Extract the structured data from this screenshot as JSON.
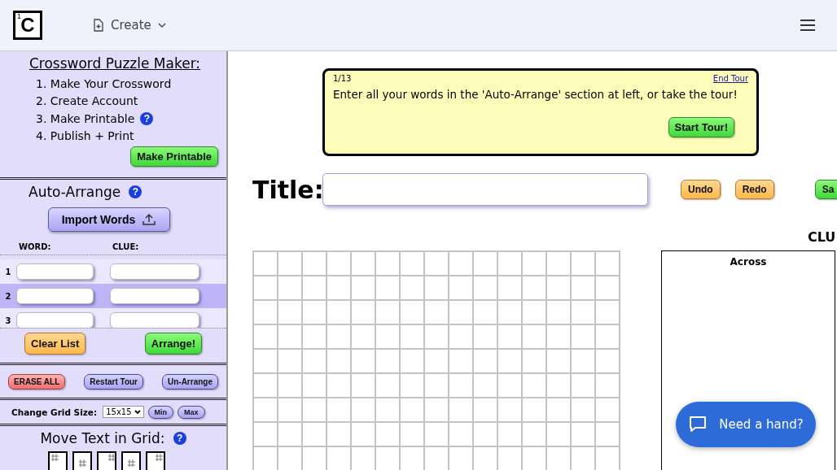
{
  "header": {
    "logo": {
      "number": "1",
      "letter": "C"
    },
    "create_menu": {
      "label": "Create"
    }
  },
  "sidebar": {
    "title": "Crossword Puzzle Maker:",
    "steps": [
      {
        "text": "1. Make Your Crossword"
      },
      {
        "text": "2. Create Account"
      },
      {
        "text": "3. Make Printable",
        "help": "?"
      },
      {
        "text": "4. Publish + Print"
      }
    ],
    "make_printable_button": "Make Printable",
    "auto_arrange": {
      "title": "Auto-Arrange",
      "help": "?",
      "import_button": "Import Words",
      "columns": [
        "WORD:",
        "CLUE:"
      ],
      "rows": [
        {
          "number": "1",
          "selected": false
        },
        {
          "number": "2",
          "selected": true
        },
        {
          "number": "3",
          "selected": false
        }
      ],
      "clear_button": "Clear List",
      "arrange_button": "Arrange!"
    },
    "actions": [
      {
        "label": "ERASE ALL",
        "kind": "danger"
      },
      {
        "label": "Restart Tour",
        "kind": "plain"
      },
      {
        "label": "Un-Arrange",
        "kind": "plain"
      }
    ],
    "grid_size": {
      "label": "Change Grid Size:",
      "value": "15x15",
      "buttons": [
        "Min",
        "Max"
      ]
    },
    "move_text": {
      "title": "Move Text in Grid:",
      "help": "?"
    }
  },
  "tour": {
    "step": "1/13",
    "end_link": "End Tour",
    "message": "Enter all your words in the 'Auto-Arrange' section at left, or take the tour!",
    "start_button": "Start Tour!"
  },
  "title_field": {
    "label": "Title:"
  },
  "toolbar": [
    {
      "label": "Undo",
      "kind": "orange"
    },
    {
      "label": "Redo",
      "kind": "orange"
    },
    {
      "label": "Sa",
      "kind": "green"
    }
  ],
  "clues": {
    "heading": "CLU",
    "across": "Across"
  },
  "chat_button": "Need a hand?"
}
